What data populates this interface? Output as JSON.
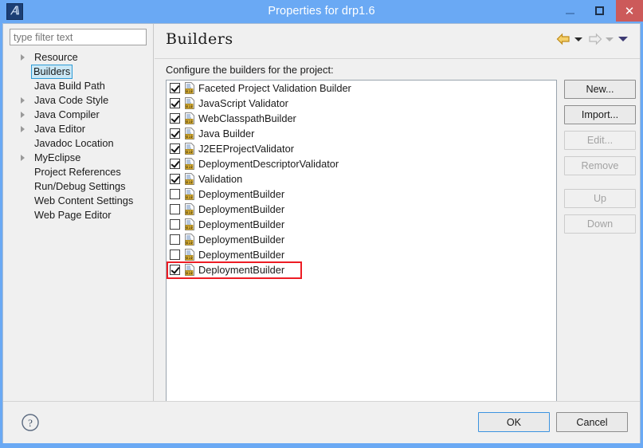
{
  "window": {
    "title": "Properties for drp1.6",
    "app_icon": "myeclipse-logo-icon",
    "minimize_label": "–",
    "maximize_label": "□",
    "close_label": "✕",
    "titlebar_color": "#6aa9f4",
    "close_button_color": "#cc5a5a"
  },
  "sidebar": {
    "filter": {
      "placeholder": "type filter text",
      "value": ""
    },
    "items": [
      {
        "label": "Resource",
        "expandable": true,
        "selected": false
      },
      {
        "label": "Builders",
        "expandable": false,
        "selected": true
      },
      {
        "label": "Java Build Path",
        "expandable": false,
        "selected": false
      },
      {
        "label": "Java Code Style",
        "expandable": true,
        "selected": false
      },
      {
        "label": "Java Compiler",
        "expandable": true,
        "selected": false
      },
      {
        "label": "Java Editor",
        "expandable": true,
        "selected": false
      },
      {
        "label": "Javadoc Location",
        "expandable": false,
        "selected": false
      },
      {
        "label": "MyEclipse",
        "expandable": true,
        "selected": false
      },
      {
        "label": "Project References",
        "expandable": false,
        "selected": false
      },
      {
        "label": "Run/Debug Settings",
        "expandable": false,
        "selected": false
      },
      {
        "label": "Web Content Settings",
        "expandable": false,
        "selected": false
      },
      {
        "label": "Web Page Editor",
        "expandable": false,
        "selected": false
      }
    ]
  },
  "content": {
    "heading": "Builders",
    "instruction": "Configure the builders for the project:",
    "nav": {
      "back_icon": "back-arrow-icon",
      "back_menu_icon": "chevron-down-icon",
      "forward_icon": "forward-arrow-icon",
      "forward_menu_icon": "chevron-down-icon",
      "view_menu_icon": "chevron-down-icon"
    },
    "builders": [
      {
        "label": "Faceted Project Validation Builder",
        "checked": true
      },
      {
        "label": "JavaScript Validator",
        "checked": true
      },
      {
        "label": "WebClasspathBuilder",
        "checked": true
      },
      {
        "label": "Java Builder",
        "checked": true
      },
      {
        "label": "J2EEProjectValidator",
        "checked": true
      },
      {
        "label": "DeploymentDescriptorValidator",
        "checked": true
      },
      {
        "label": "Validation",
        "checked": true
      },
      {
        "label": "DeploymentBuilder",
        "checked": false
      },
      {
        "label": "DeploymentBuilder",
        "checked": false
      },
      {
        "label": "DeploymentBuilder",
        "checked": false
      },
      {
        "label": "DeploymentBuilder",
        "checked": false
      },
      {
        "label": "DeploymentBuilder",
        "checked": false
      },
      {
        "label": "DeploymentBuilder",
        "checked": true
      }
    ],
    "highlight": {
      "color": "#ed1c24",
      "target_label": "DeploymentBuilder"
    },
    "side_buttons": [
      {
        "label": "New...",
        "enabled": true
      },
      {
        "label": "Import...",
        "enabled": true
      },
      {
        "label": "Edit...",
        "enabled": false
      },
      {
        "label": "Remove",
        "enabled": false
      },
      {
        "label": "Up",
        "enabled": false
      },
      {
        "label": "Down",
        "enabled": false
      }
    ]
  },
  "footer": {
    "help_icon": "help-question-icon",
    "ok_label": "OK",
    "cancel_label": "Cancel"
  }
}
